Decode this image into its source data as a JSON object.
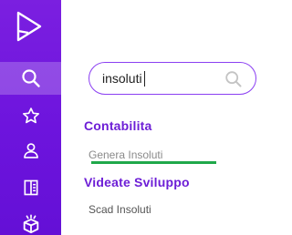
{
  "sidebar": {
    "logo": "brand-logo",
    "items": [
      {
        "icon": "search-icon",
        "active": true
      },
      {
        "icon": "star-icon",
        "active": false
      },
      {
        "icon": "user-icon",
        "active": false
      },
      {
        "icon": "book-icon",
        "active": false
      },
      {
        "icon": "box-icon",
        "active": false
      }
    ],
    "colors": {
      "background": "#6d14dd",
      "active_highlight": "#9a63e8"
    }
  },
  "search": {
    "value": "insoluti",
    "placeholder": ""
  },
  "results": {
    "groups": [
      {
        "title": "Contabilita",
        "items": [
          {
            "label": "Genera Insoluti",
            "highlight_underline_color": "#1fa84a"
          }
        ]
      },
      {
        "title": "Videate Sviluppo",
        "items": [
          {
            "label": "Scad Insoluti"
          }
        ]
      }
    ]
  },
  "colors": {
    "accent": "#6d1ed6",
    "search_border": "#8b3ff2"
  }
}
